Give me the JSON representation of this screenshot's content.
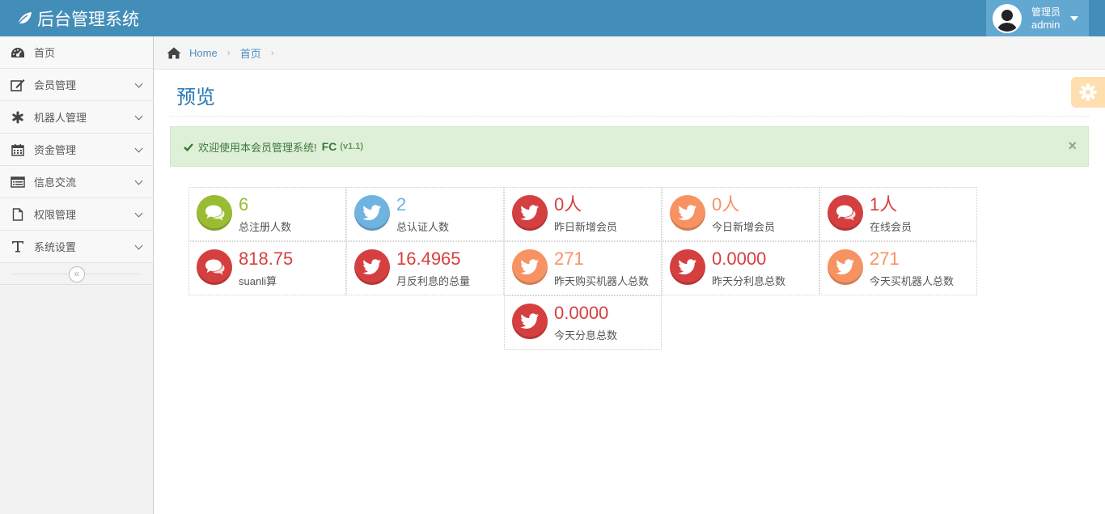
{
  "app": {
    "title": "后台管理系统"
  },
  "user": {
    "role": "管理员",
    "name": "admin"
  },
  "sidebar": {
    "items": [
      {
        "label": "首页",
        "icon": "dashboard-icon",
        "has_children": false
      },
      {
        "label": "会员管理",
        "icon": "edit-icon",
        "has_children": true
      },
      {
        "label": "机器人管理",
        "icon": "asterisk-icon",
        "has_children": true
      },
      {
        "label": "资金管理",
        "icon": "calendar-icon",
        "has_children": true
      },
      {
        "label": "信息交流",
        "icon": "list-icon",
        "has_children": true
      },
      {
        "label": "权限管理",
        "icon": "file-icon",
        "has_children": true
      },
      {
        "label": "系统设置",
        "icon": "text-icon",
        "has_children": true
      }
    ],
    "collapse_glyph": "«"
  },
  "breadcrumb": {
    "home": "Home",
    "current": "首页",
    "sep": "›"
  },
  "page": {
    "title": "预览"
  },
  "alert": {
    "message": "欢迎使用本会员管理系统!",
    "brand": "FC",
    "version": "(v1.1)",
    "close": "×"
  },
  "colors": {
    "green": "#9abc32",
    "blue": "#6fb3e0",
    "red": "#d53f40",
    "orange": "#f79263",
    "header": "#438eb9"
  },
  "stats": [
    {
      "value": "6",
      "label": "总注册人数",
      "icon": "comments-icon",
      "color": "green"
    },
    {
      "value": "2",
      "label": "总认证人数",
      "icon": "twitter-icon",
      "color": "blue"
    },
    {
      "value": "0人",
      "label": "昨日新增会员",
      "icon": "twitter-icon",
      "color": "red"
    },
    {
      "value": "0人",
      "label": "今日新增会员",
      "icon": "twitter-icon",
      "color": "orange"
    },
    {
      "value": "1人",
      "label": "在线会员",
      "icon": "comments-icon",
      "color": "red"
    },
    {
      "value": "818.75",
      "label": "suanli算",
      "icon": "comments-icon",
      "color": "red"
    },
    {
      "value": "16.4965",
      "label": "月反利息的总量",
      "icon": "twitter-icon",
      "color": "red"
    },
    {
      "value": "271",
      "label": "昨天购买机器人总数",
      "icon": "twitter-icon",
      "color": "orange"
    },
    {
      "value": "0.0000",
      "label": "昨天分利息总数",
      "icon": "twitter-icon",
      "color": "red"
    },
    {
      "value": "271",
      "label": "今天买机器人总数",
      "icon": "twitter-icon",
      "color": "orange"
    },
    {
      "value": "0.0000",
      "label": "今天分息总数",
      "icon": "twitter-icon",
      "color": "red"
    }
  ]
}
